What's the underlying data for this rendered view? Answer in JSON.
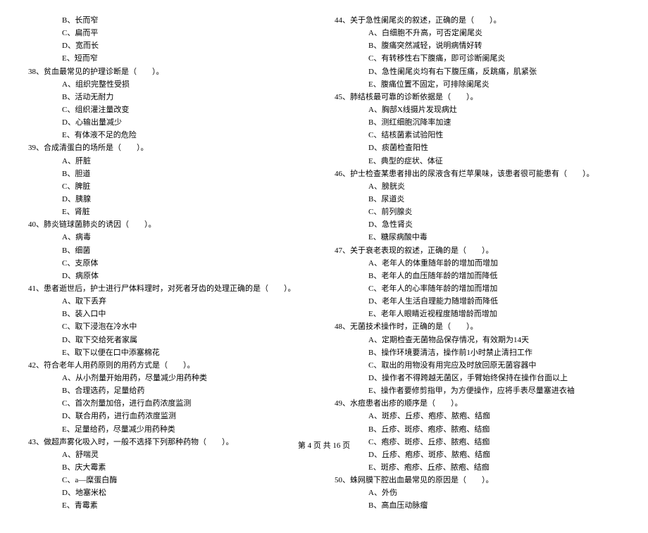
{
  "left": {
    "opts_pre": [
      "B、长而窄",
      "C、扁而平",
      "D、宽而长",
      "E、短而窄"
    ],
    "q38": "38、贫血最常见的护理诊断是（　　）。",
    "q38_opts": [
      "A、组织完整性受损",
      "B、活动无耐力",
      "C、组织灌注量改变",
      "D、心输出量减少",
      "E、有体液不足的危险"
    ],
    "q39": "39、合成清蛋白的场所是（　　）。",
    "q39_opts": [
      "A、肝脏",
      "B、胆道",
      "C、脾脏",
      "D、胰腺",
      "E、肾脏"
    ],
    "q40": "40、肺炎链球菌肺炎的诱因（　　）。",
    "q40_opts": [
      "A、病毒",
      "B、细菌",
      "C、支原体",
      "D、病原体"
    ],
    "q41": "41、患者逝世后，护士进行尸体料理时，对死者牙齿的处理正确的是（　　）。",
    "q41_opts": [
      "A、取下丢弃",
      "B、装入口中",
      "C、取下浸泡在冷水中",
      "D、取下交给死者家属",
      "E、取下以便在口中添塞棉花"
    ],
    "q42": "42、符合老年人用药原则的用药方式是（　　）。",
    "q42_opts": [
      "A、从小剂量开始用药，尽量减少用药种类",
      "B、合理选药，足量给药",
      "C、首次剂量加倍，进行血药浓度监测",
      "D、联合用药，进行血药浓度监测",
      "E、足量给药，尽量减少用药种类"
    ],
    "q43": "43、做超声雾化吸入时，一般不选择下列那种药物（　　）。",
    "q43_opts": [
      "A、舒喘灵",
      "B、庆大霉素",
      "C、a—糜蛋白酶",
      "D、地塞米松",
      "E、青霉素"
    ]
  },
  "right": {
    "q44": "44、关于急性阑尾炎的叙述，正确的是（　　）。",
    "q44_opts": [
      "A、白细胞不升高，可否定阑尾炎",
      "B、腹痛突然减轻，说明病情好转",
      "C、有转移性右下腹痛，即可诊断阑尾炎",
      "D、急性阑尾炎均有右下腹压痛，反跳痛，肌紧张",
      "E、腹痛位置不固定，可排除阑尾炎"
    ],
    "q45": "45、肺结核最可靠的诊断依据是（　　）。",
    "q45_opts": [
      "A、胸部X线摄片发现病灶",
      "B、测红细胞沉降率加速",
      "C、结核菌素试验阳性",
      "D、痰菌检查阳性",
      "E、典型的症状、体征"
    ],
    "q46": "46、护士检查某患者排出的尿液含有烂苹果味，该患者很可能患有（　　）。",
    "q46_opts": [
      "A、膀胱炎",
      "B、尿道炎",
      "C、前列腺炎",
      "D、急性肾炎",
      "E、糖尿病酸中毒"
    ],
    "q47": "47、关于衰老表现的叙述，正确的是（　　）。",
    "q47_opts": [
      "A、老年人的体重随年龄的增加而增加",
      "B、老年人的血压随年龄的增加而降低",
      "C、老年人的心率随年龄的增加而增加",
      "D、老年人生活自理能力随增龄而降低",
      "E、老年人眼睛近视程度随增龄而增加"
    ],
    "q48": "48、无菌技术操作时，正确的是（　　）。",
    "q48_opts": [
      "A、定期检查无菌物品保存情况，有效期为14天",
      "B、操作环境要清洁，操作前1小时禁止清扫工作",
      "C、取出的用物没有用完应及时放回原无菌容器中",
      "D、操作者不得跨越无菌区，手臂始终保持在操作台面以上",
      "E、操作者要修剪指甲，为方便操作，应将手表尽量塞进衣袖"
    ],
    "q49": "49、水痘患者出疹的顺序是（　　）。",
    "q49_opts": [
      "A、斑疹、丘疹、疱疹、脓疱、结痂",
      "B、丘疹、斑疹、疱疹、脓疱、结痂",
      "C、疱疹、斑疹、丘疹、脓疱、结痂",
      "D、丘疹、疱疹、斑疹、脓疱、结痂",
      "E、斑疹、疱疹、丘疹、脓疱、结痂"
    ],
    "q50": "50、蛛网膜下腔出血最常见的原因是（　　）。",
    "q50_opts": [
      "A、外伤",
      "B、高血压动脉瘤"
    ]
  },
  "footer": "第 4 页 共 16 页"
}
